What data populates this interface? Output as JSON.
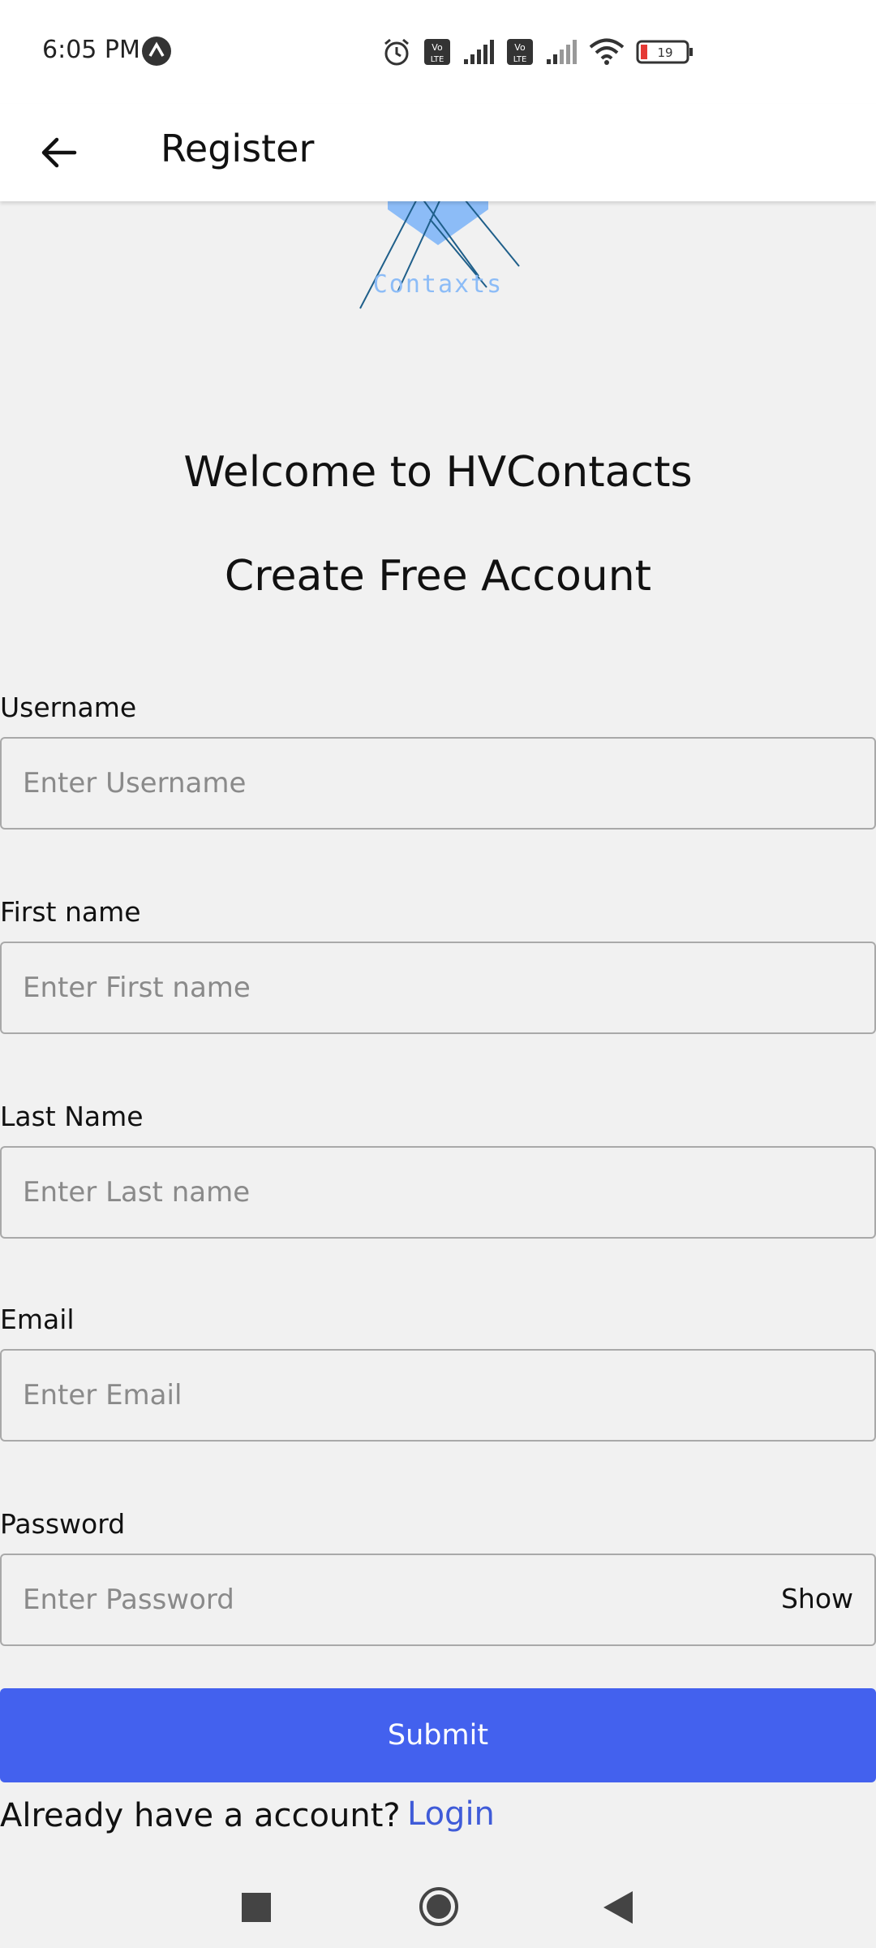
{
  "status_bar": {
    "time": "6:05 PM",
    "battery": "19"
  },
  "app_bar": {
    "title": "Register"
  },
  "logo": {
    "text": "Contaxts"
  },
  "header": {
    "welcome": "Welcome to HVContacts",
    "subtitle": "Create Free Account"
  },
  "form": {
    "username": {
      "label": "Username",
      "placeholder": "Enter Username",
      "value": ""
    },
    "first_name": {
      "label": "First name",
      "placeholder": "Enter First name",
      "value": ""
    },
    "last_name": {
      "label": "Last Name",
      "placeholder": "Enter Last name",
      "value": ""
    },
    "email": {
      "label": "Email",
      "placeholder": "Enter Email",
      "value": ""
    },
    "password": {
      "label": "Password",
      "placeholder": "Enter Password",
      "value": "",
      "toggle_label": "Show"
    },
    "submit_label": "Submit"
  },
  "footer": {
    "prompt": "Already have a  account?",
    "login_label": "Login"
  },
  "colors": {
    "accent": "#4361ee",
    "link": "#3f5bd8",
    "background": "#f1f1f1"
  }
}
